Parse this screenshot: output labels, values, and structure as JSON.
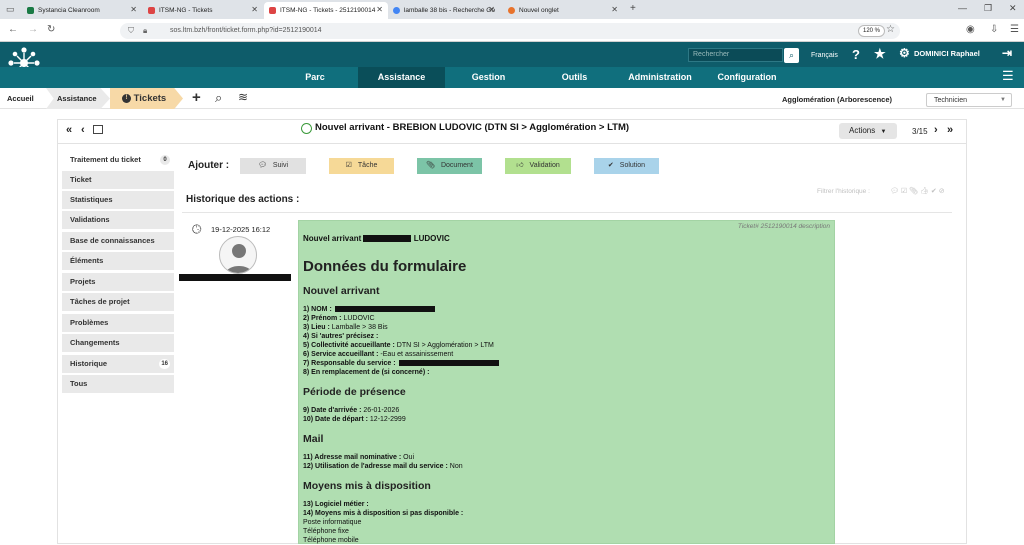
{
  "browser": {
    "tabs": [
      {
        "label": "Systancia Cleanroom",
        "color": "#1a7a45"
      },
      {
        "label": "ITSM-NG - Tickets",
        "color": "#d44"
      },
      {
        "label": "ITSM-NG - Tickets - 2512190014",
        "color": "#d44"
      },
      {
        "label": "lamballe 38 bis - Recherche Go",
        "color": "#4285f4"
      },
      {
        "label": "Nouvel onglet",
        "color": "#e8732c"
      }
    ],
    "url": "sos.ltm.bzh/front/ticket.form.php?id=2512190014",
    "zoom": "120 %"
  },
  "header": {
    "search_placeholder": "Rechercher",
    "language": "Français",
    "user": "DOMINICI Raphael"
  },
  "menu": [
    "Parc",
    "Assistance",
    "Gestion",
    "Outils",
    "Administration",
    "Configuration"
  ],
  "breadcrumb": {
    "home": "Accueil",
    "section": "Assistance",
    "current": "Tickets"
  },
  "entity": "Agglomération (Arborescence)",
  "profile": "Technicien",
  "ticket": {
    "title": "Nouvel arrivant - BREBION LUDOVIC (DTN SI > Agglomération > LTM)",
    "actions": "Actions",
    "pager": "3/15"
  },
  "sidebar": [
    {
      "label": "Traitement du ticket",
      "count": "0"
    },
    {
      "label": "Ticket"
    },
    {
      "label": "Statistiques"
    },
    {
      "label": "Validations"
    },
    {
      "label": "Base de connaissances"
    },
    {
      "label": "Éléments"
    },
    {
      "label": "Projets"
    },
    {
      "label": "Tâches de projet"
    },
    {
      "label": "Problèmes"
    },
    {
      "label": "Changements"
    },
    {
      "label": "Historique",
      "count": "16"
    },
    {
      "label": "Tous"
    }
  ],
  "add": {
    "label": "Ajouter :",
    "buttons": [
      {
        "label": "Suivi",
        "color": "#e1e1e1"
      },
      {
        "label": "Tâche",
        "color": "#f6d997"
      },
      {
        "label": "Document",
        "color": "#7cc4a7"
      },
      {
        "label": "Validation",
        "color": "#b2e08f"
      },
      {
        "label": "Solution",
        "color": "#a9d3ea"
      }
    ]
  },
  "history": {
    "title": "Historique des actions :",
    "filter": "Filtrer l'historique :",
    "date": "19-12-2025 16:12",
    "tag": "Ticket# 2512190014 description"
  },
  "content": {
    "heading_line_a": "Nouvel arrivant",
    "heading_line_b": "LUDOVIC",
    "form_title": "Données du formulaire",
    "sections": [
      {
        "title": "Nouvel arrivant",
        "lines": [
          {
            "label": "1) NOM :",
            "value": ""
          },
          {
            "label": "2) Prénom :",
            "value": " LUDOVIC"
          },
          {
            "label": "3) Lieu :",
            "value": " Lamballe > 38 Bis"
          },
          {
            "label": "4) Si 'autres' précisez :",
            "value": ""
          },
          {
            "label": "5) Collectivité accueillante :",
            "value": " DTN SI > Agglomération > LTM"
          },
          {
            "label": "6) Service accueillant :",
            "value": " -Eau et assainissement"
          },
          {
            "label": "7) Responsable du service :",
            "value": ""
          },
          {
            "label": "8) En remplacement de (si concerné) :",
            "value": ""
          }
        ]
      },
      {
        "title": "Période de présence",
        "lines": [
          {
            "label": "9) Date d'arrivée :",
            "value": " 26-01-2026"
          },
          {
            "label": "10) Date de départ :",
            "value": " 12-12-2999"
          }
        ]
      },
      {
        "title": "Mail",
        "lines": [
          {
            "label": "11) Adresse mail nominative :",
            "value": " Oui"
          },
          {
            "label": "12) Utilisation de l'adresse mail du service :",
            "value": " Non"
          }
        ]
      },
      {
        "title": "Moyens mis à disposition",
        "lines": [
          {
            "label": "13) Logiciel métier :",
            "value": ""
          },
          {
            "label": "14) Moyens mis à disposition si pas disponible :",
            "value": ""
          }
        ],
        "extra": [
          "Poste informatique",
          "Téléphone fixe",
          "Téléphone mobile"
        ]
      }
    ]
  }
}
